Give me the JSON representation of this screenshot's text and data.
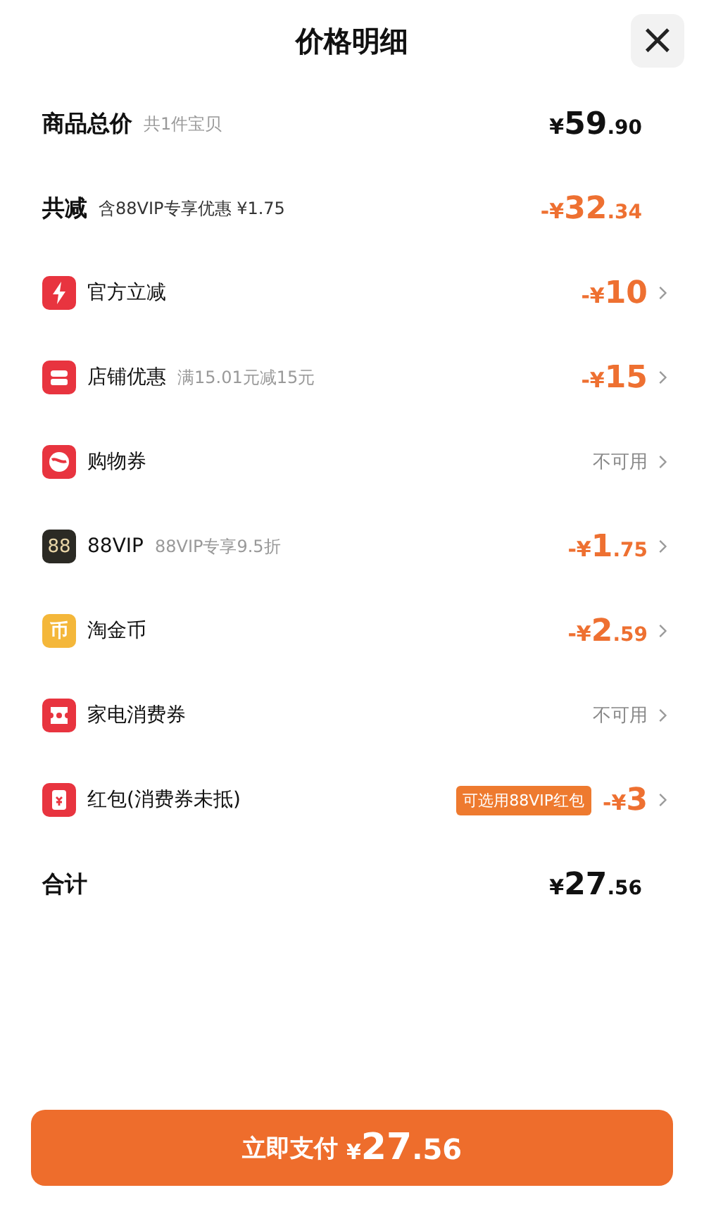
{
  "header": {
    "title": "价格明细",
    "close": "×"
  },
  "rows": [
    {
      "kind": "subtotal",
      "label": "商品总价",
      "note": "共1件宝贝",
      "amount": {
        "prefix": "¥",
        "whole": "59",
        "fraction": ".90"
      },
      "chevron": false
    },
    {
      "kind": "savings",
      "label": "共减",
      "note": "含88VIP专享优惠 ¥1.75",
      "amount": {
        "prefix": "-¥",
        "whole": "32",
        "fraction": ".34"
      },
      "chevron": false
    },
    {
      "kind": "lightning",
      "label": "官方立减",
      "amount": {
        "prefix": "-¥",
        "whole": "10"
      },
      "chevron": true
    },
    {
      "kind": "shop",
      "label": "店铺优惠",
      "note": "满15.01元减15元",
      "amount": {
        "prefix": "-¥",
        "whole": "15"
      },
      "chevron": true
    },
    {
      "kind": "coupon",
      "label": "购物券",
      "status": "不可用",
      "chevron": true
    },
    {
      "kind": "vip",
      "icon_text": "88",
      "label": "88VIP",
      "note": "88VIP专享9.5折",
      "amount": {
        "prefix": "-¥",
        "whole": "1",
        "fraction": ".75"
      },
      "chevron": true
    },
    {
      "kind": "coin",
      "icon_text": "币",
      "label": "淘金币",
      "amount": {
        "prefix": "-¥",
        "whole": "2",
        "fraction": ".59"
      },
      "chevron": true
    },
    {
      "kind": "ticket",
      "label": "家电消费券",
      "status": "不可用",
      "chevron": true
    },
    {
      "kind": "envelope",
      "label": "红包(消费券未抵)",
      "badge": "可选用88VIP红包",
      "amount": {
        "prefix": "-¥",
        "whole": "3"
      },
      "chevron": true
    },
    {
      "kind": "total",
      "label": "合计",
      "amount": {
        "prefix": "¥",
        "whole": "27",
        "fraction": ".56"
      },
      "chevron": false
    }
  ],
  "pay_button": {
    "label": "立即支付",
    "amount": {
      "prefix": "¥",
      "whole": "27",
      "fraction": ".56"
    }
  }
}
